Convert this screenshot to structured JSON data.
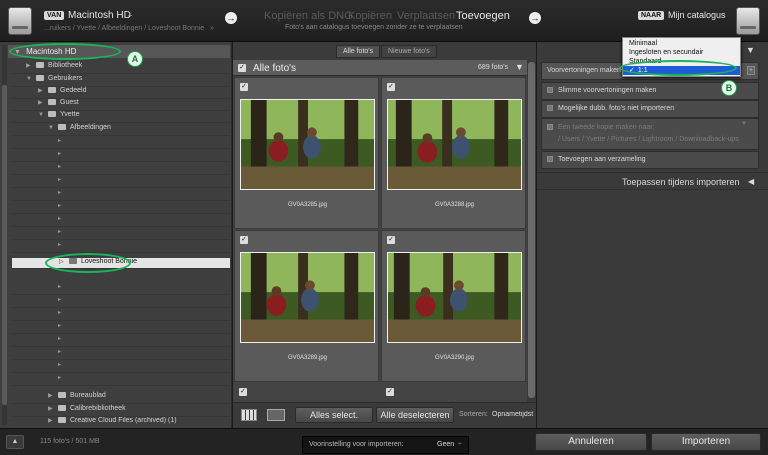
{
  "topbar": {
    "from_tag": "VAN",
    "source_name": "Macintosh HD",
    "source_path": "...ruikers / Yvette / Afbeeldingen / Loveshoot Bonnie",
    "modes": [
      "Kopiëren als DNG",
      "Kopiëren",
      "Verplaatsen",
      "Toevoegen"
    ],
    "active_mode_index": 3,
    "mode_subtitle": "Foto's aan catalogus toevoegen zonder ze te verplaatsen",
    "to_tag": "NAAR",
    "dest_name": "Mijn catalogus"
  },
  "source_panel": {
    "header": "Macintosh HD",
    "items": [
      {
        "label": "Bibliotheek",
        "depth": 1,
        "expanded": false
      },
      {
        "label": "Gebruikers",
        "depth": 1,
        "expanded": true
      },
      {
        "label": "Gedeeld",
        "depth": 2,
        "expanded": false
      },
      {
        "label": "Guest",
        "depth": 2,
        "expanded": false
      },
      {
        "label": "Yvette",
        "depth": 2,
        "expanded": true
      },
      {
        "label": "Afbeeldingen",
        "depth": 3,
        "expanded": true
      },
      {
        "label": "Loveshoot Bonnie",
        "depth": 4,
        "expanded": false,
        "selected": true
      },
      {
        "label": "Bureaublad",
        "depth": 3,
        "expanded": false
      },
      {
        "label": "Calibrebibliotheek",
        "depth": 3,
        "expanded": false
      },
      {
        "label": "Creative Cloud Files (archived) (1)",
        "depth": 3,
        "expanded": false
      }
    ],
    "callout": "A"
  },
  "grid": {
    "tabs": [
      "Alle foto's",
      "Nieuwe foto's"
    ],
    "active_tab": 0,
    "header_label": "Alle foto's",
    "count": "689 foto's",
    "photos": [
      {
        "name": "GV0A3285.jpg",
        "checked": true
      },
      {
        "name": "GV0A3288.jpg",
        "checked": true
      },
      {
        "name": "GV0A3289.jpg",
        "checked": true
      },
      {
        "name": "GV0A3290.jpg",
        "checked": true
      }
    ],
    "select_all": "Alles select.",
    "deselect_all": "Alle deselecteren",
    "sort_label": "Sorteren:",
    "sort_value": "Opnametijdst"
  },
  "right_panel": {
    "previews_label": "Voorvertoningen maken",
    "preview_options": [
      "Minimaal",
      "Ingesloten en secundair",
      "Standaard",
      "1:1"
    ],
    "preview_selected_index": 3,
    "options": [
      {
        "label": "Slimme voorvertoningen maken"
      },
      {
        "label": "Mogelijke dubb. foto's niet importeren"
      },
      {
        "label": "Een tweede kopie maken naar:"
      },
      {
        "label": "Toevoegen aan verzameling"
      }
    ],
    "second_copy_path": "/ Users / Yvette / Pictures / Lightroom / Downloadback-ups",
    "apply_during_import": "Toepassen tijdens importeren",
    "callout": "B"
  },
  "bottom": {
    "status": "115 foto's / 501 MB",
    "preset_label": "Voorinstelling voor importeren:",
    "preset_value": "Geen",
    "cancel": "Annuleren",
    "import": "Importeren"
  },
  "colors": {
    "selection_blue": "#1e5bd6",
    "callout_green": "#1ab55a"
  }
}
